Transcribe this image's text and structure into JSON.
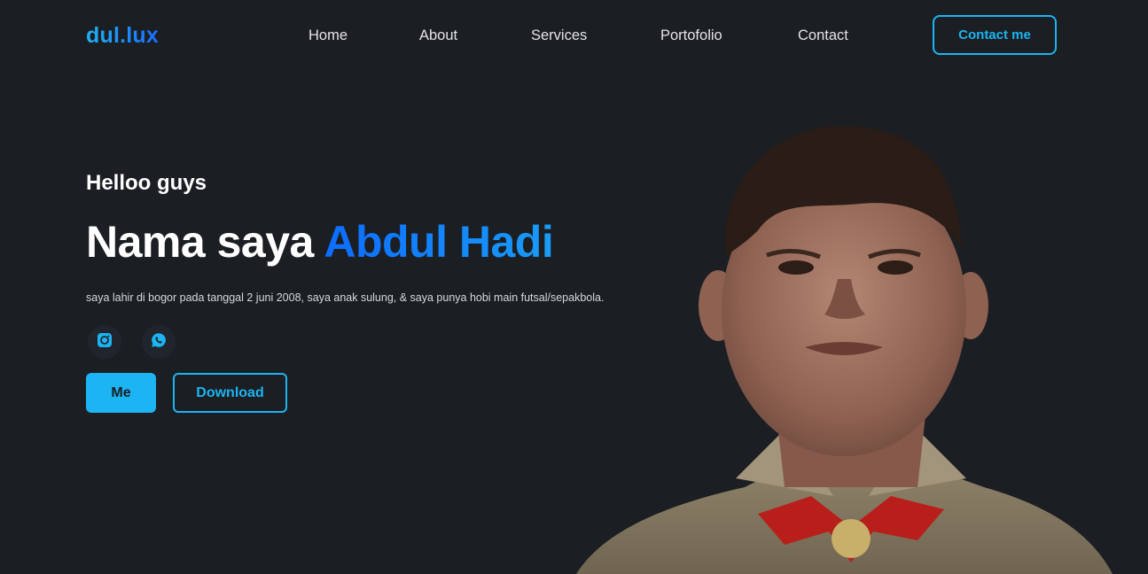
{
  "brand": {
    "logo_text": "dul.lux"
  },
  "nav": {
    "items": [
      {
        "label": "Home"
      },
      {
        "label": "About"
      },
      {
        "label": "Services"
      },
      {
        "label": "Portofolio"
      },
      {
        "label": "Contact"
      }
    ],
    "cta_label": "Contact me"
  },
  "hero": {
    "greeting": "Helloo guys",
    "title_prefix": "Nama saya ",
    "title_name": "Abdul Hadi",
    "description": "saya lahir di bogor pada tanggal 2 juni 2008, saya anak sulung, & saya punya hobi main futsal/sepakbola.",
    "socials": [
      {
        "icon": "instagram-icon"
      },
      {
        "icon": "whatsapp-icon"
      }
    ],
    "buttons": {
      "primary_label": "Me",
      "secondary_label": "Download"
    }
  },
  "colors": {
    "background": "#1b1e23",
    "accent": "#1cb4f2",
    "name_gradient_start": "#0d6cff",
    "name_gradient_end": "#1a9cf5"
  }
}
